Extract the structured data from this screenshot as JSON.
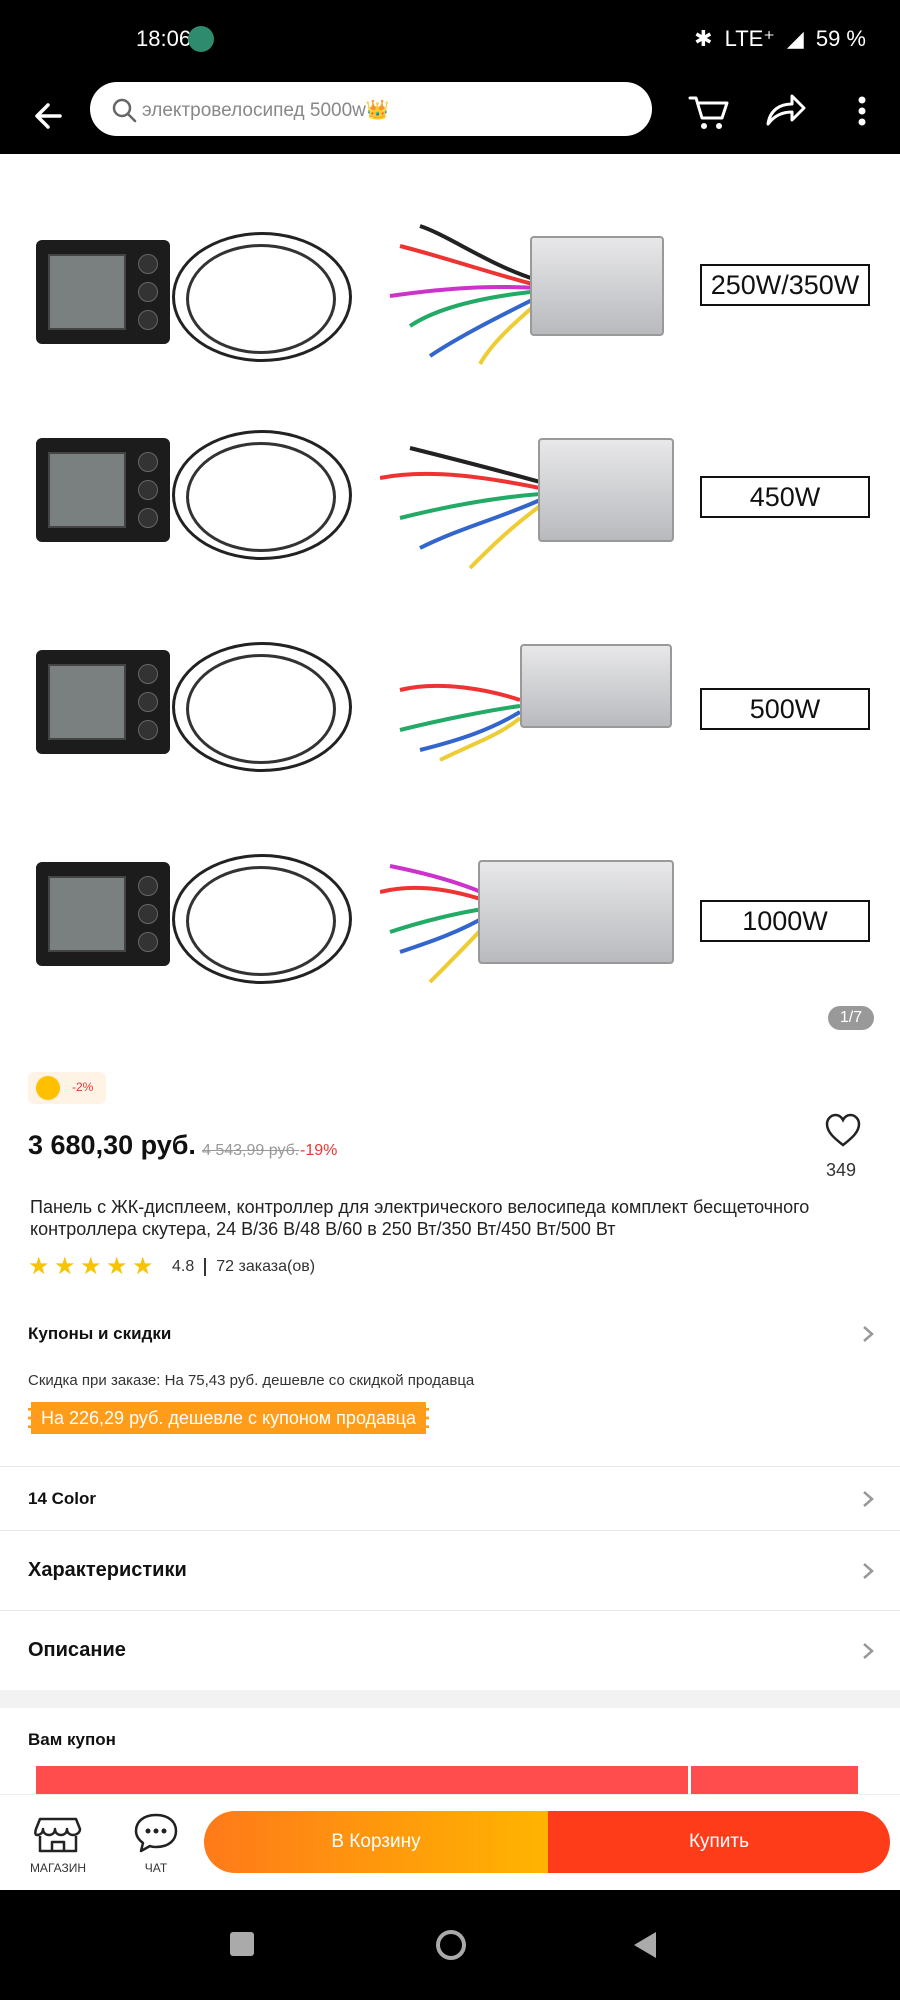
{
  "status_bar": {
    "time": "18:06",
    "network": "LTE⁺",
    "battery": "59 %"
  },
  "search": {
    "query": "электровелосипед 5000w👑"
  },
  "gallery": {
    "items": [
      {
        "label": "250W/350W"
      },
      {
        "label": "450W"
      },
      {
        "label": "500W"
      },
      {
        "label": "1000W"
      }
    ],
    "page_indicator": "1/7"
  },
  "product": {
    "promo_badge": "-2%",
    "price": "3 680,30 руб.",
    "old_price": "4 543,99 руб.",
    "discount": "-19%",
    "wishlist_count": "349",
    "title": "Панель с ЖК-дисплеем, контроллер для электрического велосипеда комплект бесщеточного контроллера скутера, 24 В/36 В/48 В/60 в 250 Вт/350 Вт/450 Вт/500 Вт",
    "rating": "4.8",
    "rating_stars": 5,
    "orders": "72 заказа(ов)"
  },
  "sections": {
    "coupons": {
      "title": "Купоны и скидки",
      "detail": "Скидка при заказе: На 75,43 руб. дешевле со скидкой продавца",
      "tag": "На 226,29 руб. дешевле с купоном продавца"
    },
    "color": "14 Color",
    "specs": "Характеристики",
    "description": "Описание",
    "your_coupon": "Вам купон"
  },
  "bottom_actions": {
    "shop_label": "МАГАЗИН",
    "chat_label": "ЧАТ",
    "cart_label": "В Корзину",
    "buy_label": "Купить"
  },
  "colors": {
    "accent_orange": "#ff9c1a",
    "buy_red": "#ff3c1a",
    "discount_red": "#e33333",
    "star_yellow": "#f7c400"
  }
}
